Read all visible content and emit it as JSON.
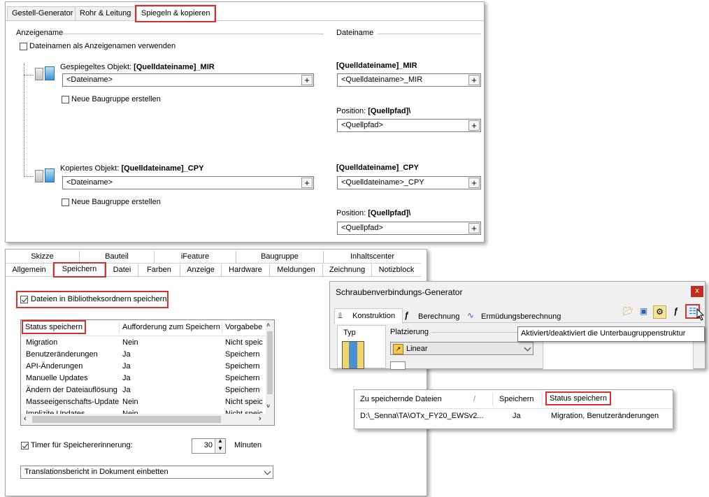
{
  "panel1": {
    "tabs": [
      "Gestell-Generator",
      "Rohr & Leitung",
      "Spiegeln & kopieren"
    ],
    "anzeigename_header": "Anzeigename",
    "dateiname_header": "Dateiname",
    "use_filename_label": "Dateinamen als Anzeigenamen verwenden",
    "mirrored": {
      "label_prefix": "Gespiegeltes Objekt: ",
      "label_bold": "[Quelldateiname]_MIR",
      "field_value": "<Dateiname>",
      "new_assembly_label": "Neue Baugruppe erstellen",
      "file_header": "[Quelldateiname]_MIR",
      "file_value": "<Quelldateiname>_MIR",
      "position_prefix": "Position: ",
      "position_bold": "[Quellpfad]\\",
      "position_value": "<Quellpfad>"
    },
    "copied": {
      "label_prefix": "Kopiertes Objekt: ",
      "label_bold": "[Quelldateiname]_CPY",
      "field_value": "<Dateiname>",
      "new_assembly_label": "Neue Baugruppe erstellen",
      "file_header": "[Quelldateiname]_CPY",
      "file_value": "<Quelldateiname>_CPY",
      "position_prefix": "Position: ",
      "position_bold": "[Quellpfad]\\",
      "position_value": "<Quellpfad>"
    },
    "plus": "+"
  },
  "panel2": {
    "tabs_row1": [
      "Skizze",
      "Bauteil",
      "iFeature",
      "Baugruppe",
      "Inhaltscenter"
    ],
    "tabs_row2": [
      "Allgemein",
      "Speichern",
      "Datei",
      "Farben",
      "Anzeige",
      "Hardware",
      "Meldungen",
      "Zeichnung",
      "Notizblock"
    ],
    "library_checkbox_label": "Dateien in Bibliotheksordnern speichern",
    "columns": [
      "Status speichern",
      "Aufforderung zum Speichern",
      "Vorgabebe"
    ],
    "rows": [
      [
        "Migration",
        "Nein",
        "Nicht speic"
      ],
      [
        "Benutzeränderungen",
        "Ja",
        "Speichern"
      ],
      [
        "API-Änderungen",
        "Ja",
        "Speichern"
      ],
      [
        "Manuelle Updates",
        "Ja",
        "Speichern"
      ],
      [
        "Ändern der Dateiauflösung",
        "Ja",
        "Speichern"
      ],
      [
        "Masseeigenschafts-Update",
        "Nein",
        "Nicht speic"
      ],
      [
        "Implizite Updates",
        "Nein",
        "Nicht speic"
      ]
    ],
    "timer_label": "Timer für Speichererinnerung:",
    "timer_value": "30",
    "timer_unit": "Minuten",
    "translation_combo": "Translationsbericht in Dokument einbetten"
  },
  "panel3": {
    "title": "Schraubenverbindungs-Generator",
    "close": "x",
    "tabs": [
      "Konstruktion",
      "Berechnung",
      "Ermüdungsberechnung"
    ],
    "typ_label": "Typ",
    "platzierung_label": "Platzierung",
    "platzierung_value": "Linear",
    "tooltip": "Aktiviert/deaktiviert die Unterbaugruppenstruktur"
  },
  "panel4": {
    "columns": [
      "Zu speichernde Dateien",
      "Speichern",
      "Status speichern"
    ],
    "sort_glyph": "/",
    "row": [
      "D:\\_Senna\\TA\\OTx_FY20_EWSv2...",
      "Ja",
      "Migration, Benutzeränderungen"
    ]
  },
  "colors": {
    "highlight": "#d7312e",
    "close_button": "#c42b1c",
    "accent_blue": "#3a94d6"
  }
}
